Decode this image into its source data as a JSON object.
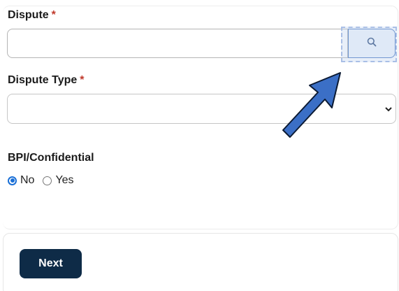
{
  "form": {
    "dispute": {
      "label": "Dispute",
      "required_mark": "*",
      "value": "",
      "placeholder": ""
    },
    "dispute_type": {
      "label": "Dispute Type",
      "required_mark": "*",
      "selected": ""
    },
    "bpi": {
      "label": "BPI/Confidential",
      "options": [
        {
          "label": "No",
          "checked": true
        },
        {
          "label": "Yes",
          "checked": false
        }
      ]
    }
  },
  "actions": {
    "next_label": "Next"
  },
  "icons": {
    "search": "search-icon",
    "select": "chevron-down-icon",
    "annotation": "arrow-pointer-icon"
  },
  "colors": {
    "primary_button": "#0e2b47",
    "required": "#c0392b",
    "radio_checked": "#1a6fd6",
    "annotation_arrow": "#3b6fc6",
    "highlight": "#a9bfe6"
  }
}
